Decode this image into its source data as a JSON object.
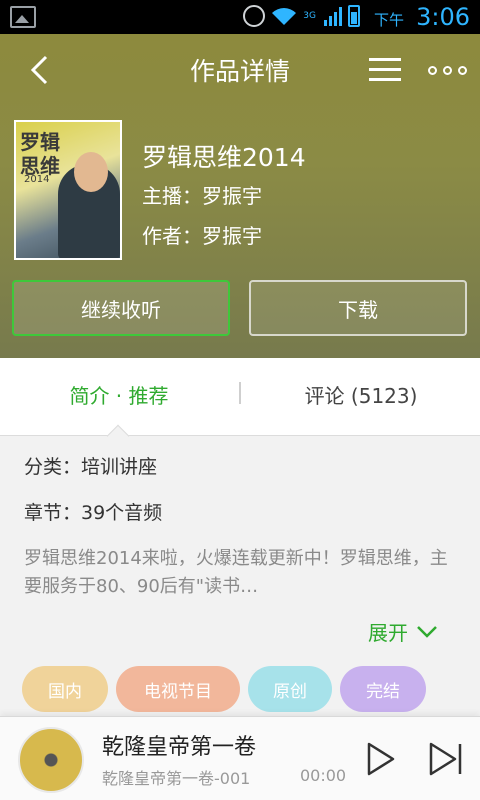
{
  "status_bar": {
    "time_prefix": "下午",
    "time": "3:06",
    "network": "3G",
    "accent_color": "#2fb5ff"
  },
  "header": {
    "title": "作品详情",
    "back_icon": "chevron-left-icon",
    "menu_icon": "list-icon",
    "more_icon": "more-dots-icon"
  },
  "album": {
    "title": "罗辑思维2014",
    "host": "主播：罗振宇",
    "author": "作者：罗振宇",
    "cover_title": "罗辑思维",
    "cover_year": "2014"
  },
  "actions": {
    "listen_label": "继续收听",
    "download_label": "下载"
  },
  "tabs": {
    "intro_label": "简介 · 推荐",
    "comments_label": "评论 (5123)",
    "active_color": "#2faa2f"
  },
  "info": {
    "category": "分类：培训讲座",
    "chapters": "章节：39个音频",
    "description": "罗辑思维2014来啦，火爆连载更新中！罗辑思维，主要服务于80、90后有\"读书…",
    "expand_label": "展开"
  },
  "tags": [
    "国内",
    "电视节目",
    "原创",
    "完结"
  ],
  "player": {
    "title": "乾隆皇帝第一卷",
    "subtitle": "乾隆皇帝第一卷-001",
    "elapsed": "00:00"
  }
}
